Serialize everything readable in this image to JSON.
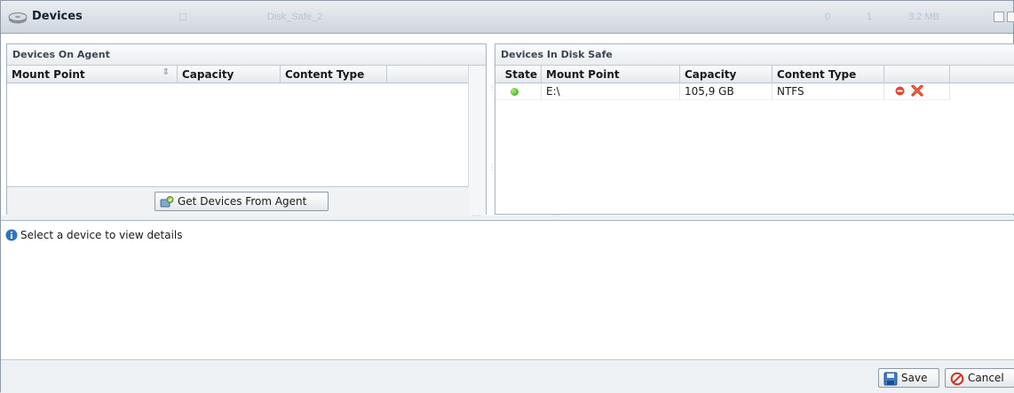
{
  "window": {
    "title": "Devices",
    "ghost_text": [
      "Disk_Safe_2",
      "0",
      "1",
      "3.2 MB"
    ]
  },
  "left_panel": {
    "title": "Devices On Agent",
    "columns": [
      "Mount Point",
      "Capacity",
      "Content Type"
    ],
    "rows": [],
    "get_devices_label": "Get Devices From Agent"
  },
  "right_panel": {
    "title": "Devices In Disk Safe",
    "columns": [
      "State",
      "Mount Point",
      "Capacity",
      "Content Type"
    ],
    "rows": [
      {
        "state": "online",
        "mount_point": "E:\\",
        "capacity": "105,9 GB",
        "content_type": "NTFS"
      }
    ]
  },
  "details": {
    "message": "Select a device to view details"
  },
  "footer": {
    "save_label": "Save",
    "cancel_label": "Cancel"
  },
  "colors": {
    "state_ok": "#2e9a14",
    "remove": "#d9381e"
  }
}
